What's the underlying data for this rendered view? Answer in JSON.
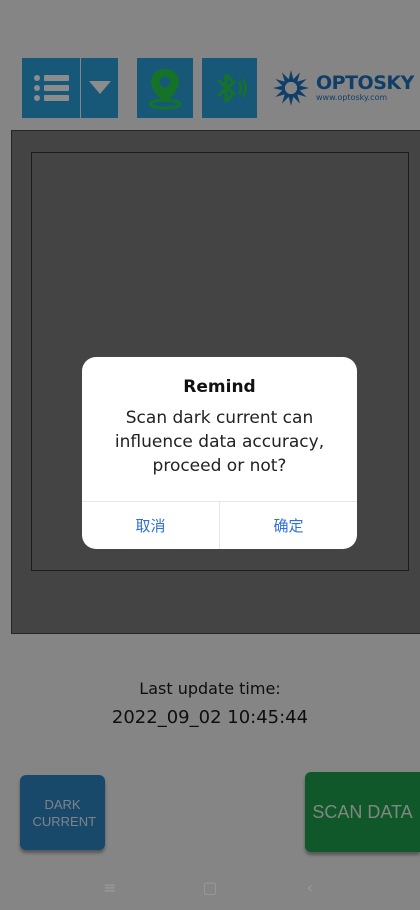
{
  "app": {
    "logo": {
      "name": "OPTOSKY",
      "url": "www.optosky.com"
    }
  },
  "toolbar": {
    "menu_icon": "list-menu-icon",
    "dropdown_icon": "triangle-down-icon",
    "location_icon": "location-pin-icon",
    "bluetooth_icon": "bluetooth-icon"
  },
  "status": {
    "label": "Last update time:",
    "time": "2022_09_02 10:45:44"
  },
  "buttons": {
    "dark_current": "DARK CURRENT",
    "scan_data": "SCAN DATA"
  },
  "dialog": {
    "title": "Remind",
    "message": "Scan dark current can influence data accuracy, proceed or not?",
    "cancel": "取消",
    "confirm": "确定"
  },
  "navbar": {
    "menu": "≡",
    "home": "▢",
    "back": "‹"
  },
  "colors": {
    "toolbar_blue": "#2aa1db",
    "dark_current_blue": "#2c86c4",
    "scan_green": "#1e9e4c",
    "dialog_action_blue": "#2f6fd8",
    "panel_gray": "#7c7c7c"
  }
}
